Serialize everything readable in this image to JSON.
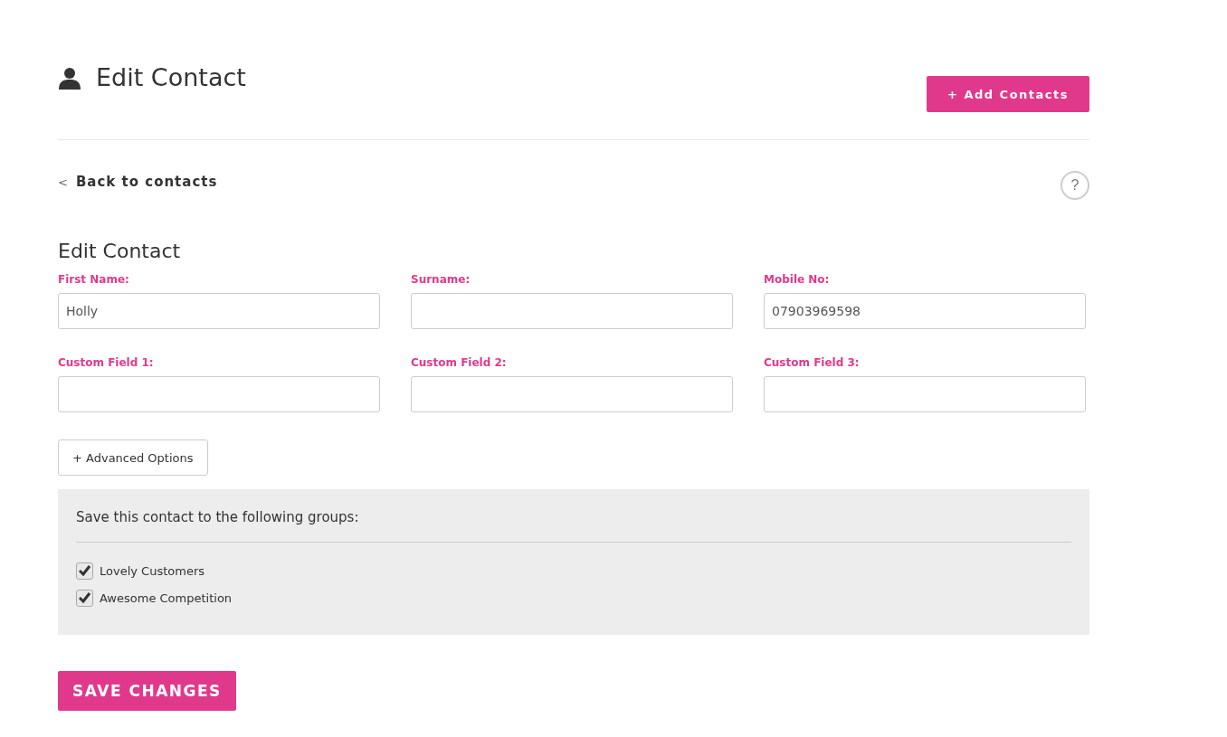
{
  "header": {
    "title": "Edit Contact",
    "add_button": "+ Add Contacts"
  },
  "back_link": {
    "chevron": "<",
    "label": "Back to contacts"
  },
  "help": {
    "label": "?"
  },
  "form": {
    "title": "Edit Contact",
    "fields": [
      {
        "label": "First Name:",
        "value": "Holly"
      },
      {
        "label": "Surname:"
      },
      {
        "label": "Mobile No:",
        "value": "07903969598"
      },
      {
        "label": "Custom Field 1:"
      },
      {
        "label": "Custom Field 2:"
      },
      {
        "label": "Custom Field 3:"
      }
    ],
    "advanced_button": "+ Advanced Options"
  },
  "groups": {
    "title": "Save this contact to the following groups:",
    "items": [
      {
        "label": "Lovely Customers",
        "checked": true
      },
      {
        "label": "Awesome Competition",
        "checked": true
      }
    ]
  },
  "save_button": "SAVE CHANGES"
}
